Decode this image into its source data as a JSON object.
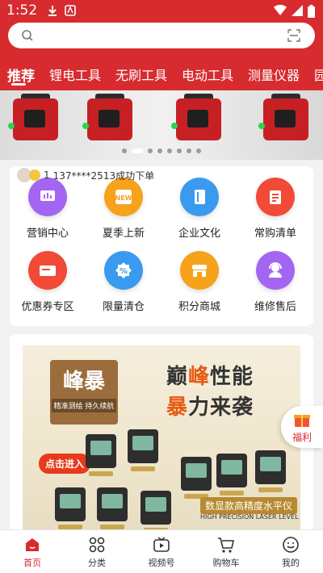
{
  "status_bar": {
    "time": "1:52"
  },
  "search": {
    "placeholder": ""
  },
  "tabs": [
    {
      "label": "推荐",
      "active": true
    },
    {
      "label": "锂电工具"
    },
    {
      "label": "无刷工具"
    },
    {
      "label": "电动工具"
    },
    {
      "label": "测量仪器"
    },
    {
      "label": "园"
    }
  ],
  "banner": {
    "slides": 8,
    "active_slide": 0
  },
  "ticker": {
    "count": "1",
    "message": "137****2513成功下单"
  },
  "menu": [
    {
      "label": "营销中心",
      "icon": "chart-icon",
      "color": "#a366f2"
    },
    {
      "label": "夏季上新",
      "icon": "new-icon",
      "color": "#f6a21b"
    },
    {
      "label": "企业文化",
      "icon": "book-icon",
      "color": "#3a9af0"
    },
    {
      "label": "常购清单",
      "icon": "list-icon",
      "color": "#f24a36"
    },
    {
      "label": "优惠券专区",
      "icon": "coupon-icon",
      "color": "#f24a36"
    },
    {
      "label": "限量清仓",
      "icon": "discount-icon",
      "color": "#3a9af0"
    },
    {
      "label": "积分商城",
      "icon": "store-icon",
      "color": "#f6a21b"
    },
    {
      "label": "维修售后",
      "icon": "support-icon",
      "color": "#a366f2"
    }
  ],
  "promo": {
    "brand": "峰暴",
    "brand_sub": "精准测绘 持久续航",
    "headline_a": "巅",
    "headline_b": "峰",
    "headline_c": "性能",
    "headline_d": "暴",
    "headline_e": "力来袭",
    "click_label": "点击进入",
    "tag": "数显款高精度水平仪",
    "tag_en": "HIGH PRECISION LASER LEVEL"
  },
  "float_button": {
    "label": "福利"
  },
  "bottom_nav": [
    {
      "label": "首页",
      "icon": "home-icon",
      "active": true
    },
    {
      "label": "分类",
      "icon": "category-icon"
    },
    {
      "label": "视频号",
      "icon": "video-icon"
    },
    {
      "label": "购物车",
      "icon": "cart-icon"
    },
    {
      "label": "我的",
      "icon": "profile-icon"
    }
  ],
  "colors": {
    "brand_red": "#d72b2f",
    "accent_orange": "#e85a10"
  }
}
